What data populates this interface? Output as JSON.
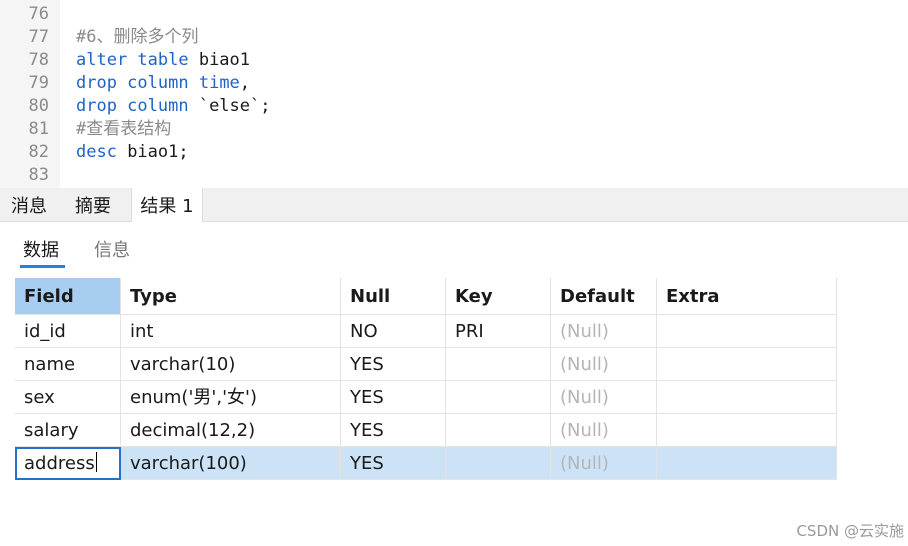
{
  "editor": {
    "lines": [
      {
        "num": "76",
        "parts": []
      },
      {
        "num": "77",
        "parts": [
          {
            "t": "#6、删除多个列",
            "c": "cm"
          }
        ]
      },
      {
        "num": "78",
        "parts": [
          {
            "t": "alter table",
            "c": "kw"
          },
          {
            "t": " biao1",
            "c": "tx"
          }
        ]
      },
      {
        "num": "79",
        "parts": [
          {
            "t": "drop column",
            "c": "kw"
          },
          {
            "t": " ",
            "c": "tx"
          },
          {
            "t": "time",
            "c": "kw"
          },
          {
            "t": ",",
            "c": "tx"
          }
        ]
      },
      {
        "num": "80",
        "parts": [
          {
            "t": "drop column",
            "c": "kw"
          },
          {
            "t": " `else`;",
            "c": "tx"
          }
        ]
      },
      {
        "num": "81",
        "parts": [
          {
            "t": "#查看表结构",
            "c": "cm"
          }
        ]
      },
      {
        "num": "82",
        "parts": [
          {
            "t": "desc",
            "c": "kw"
          },
          {
            "t": " biao1;",
            "c": "tx"
          }
        ]
      },
      {
        "num": "83",
        "parts": []
      }
    ]
  },
  "tabs": {
    "messages": "消息",
    "summary": "摘要",
    "result1": "结果 1"
  },
  "subtabs": {
    "data": "数据",
    "info": "信息"
  },
  "grid": {
    "headers": [
      "Field",
      "Type",
      "Null",
      "Key",
      "Default",
      "Extra"
    ],
    "rows": [
      [
        "id_id",
        "int",
        "NO",
        "PRI",
        "(Null)",
        ""
      ],
      [
        "name",
        "varchar(10)",
        "YES",
        "",
        "(Null)",
        ""
      ],
      [
        "sex",
        "enum('男','女')",
        "YES",
        "",
        "(Null)",
        ""
      ],
      [
        "salary",
        "decimal(12,2)",
        "YES",
        "",
        "(Null)",
        ""
      ],
      [
        "address",
        "varchar(100)",
        "YES",
        "",
        "(Null)",
        ""
      ]
    ],
    "selected_row_index": 4
  },
  "watermark": "CSDN @云实施"
}
